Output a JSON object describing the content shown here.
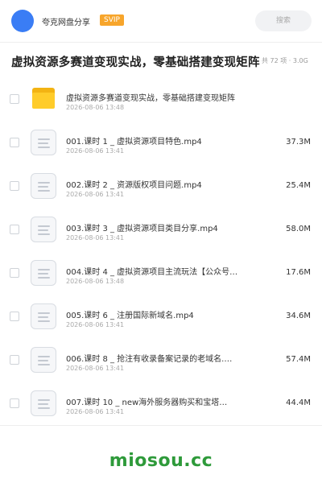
{
  "header": {
    "app_name": "夸克网盘分享",
    "vip_badge": "SVIP",
    "search_placeholder": "搜索",
    "accent": "#3a7df5",
    "badge_color": "#f7a52b"
  },
  "folder": {
    "title": "虚拟资源多赛道变现实战，零基础搭建变现矩阵",
    "meta": "共 72 项 · 3.0G"
  },
  "files": [
    {
      "name": "虚拟资源多赛道变现实战，零基础搭建变现矩阵",
      "date": "2026-08-06 13:48",
      "size": "",
      "icon": "folder-icon"
    },
    {
      "name": "001.课时 1 _ 虚拟资源项目特色.mp4",
      "date": "2026-08-06 13:41",
      "size": "37.3M",
      "icon": "video-file-icon"
    },
    {
      "name": "002.课时 2 _ 资源版权项目问题.mp4",
      "date": "2026-08-06 13:41",
      "size": "25.4M",
      "icon": "video-file-icon"
    },
    {
      "name": "003.课时 3 _ 虚拟资源项目类目分享.mp4",
      "date": "2026-08-06 13:41",
      "size": "58.0M",
      "icon": "video-file-icon"
    },
    {
      "name": "004.课时 4 _ 虚拟资源项目主流玩法【公众号…",
      "date": "2026-08-06 13:48",
      "size": "17.6M",
      "icon": "video-file-icon"
    },
    {
      "name": "005.课时 6 _ 注册国际新域名.mp4",
      "date": "2026-08-06 13:41",
      "size": "34.6M",
      "icon": "video-file-icon"
    },
    {
      "name": "006.课时 8 _ 抢注有收录备案记录的老域名.…",
      "date": "2026-08-06 13:41",
      "size": "57.4M",
      "icon": "video-file-icon"
    },
    {
      "name": "007.课时 10 _ new海外服务器购买和宝塔…",
      "date": "2026-08-06 13:41",
      "size": "44.4M",
      "icon": "video-file-icon"
    }
  ],
  "watermark": "miosou.cc"
}
